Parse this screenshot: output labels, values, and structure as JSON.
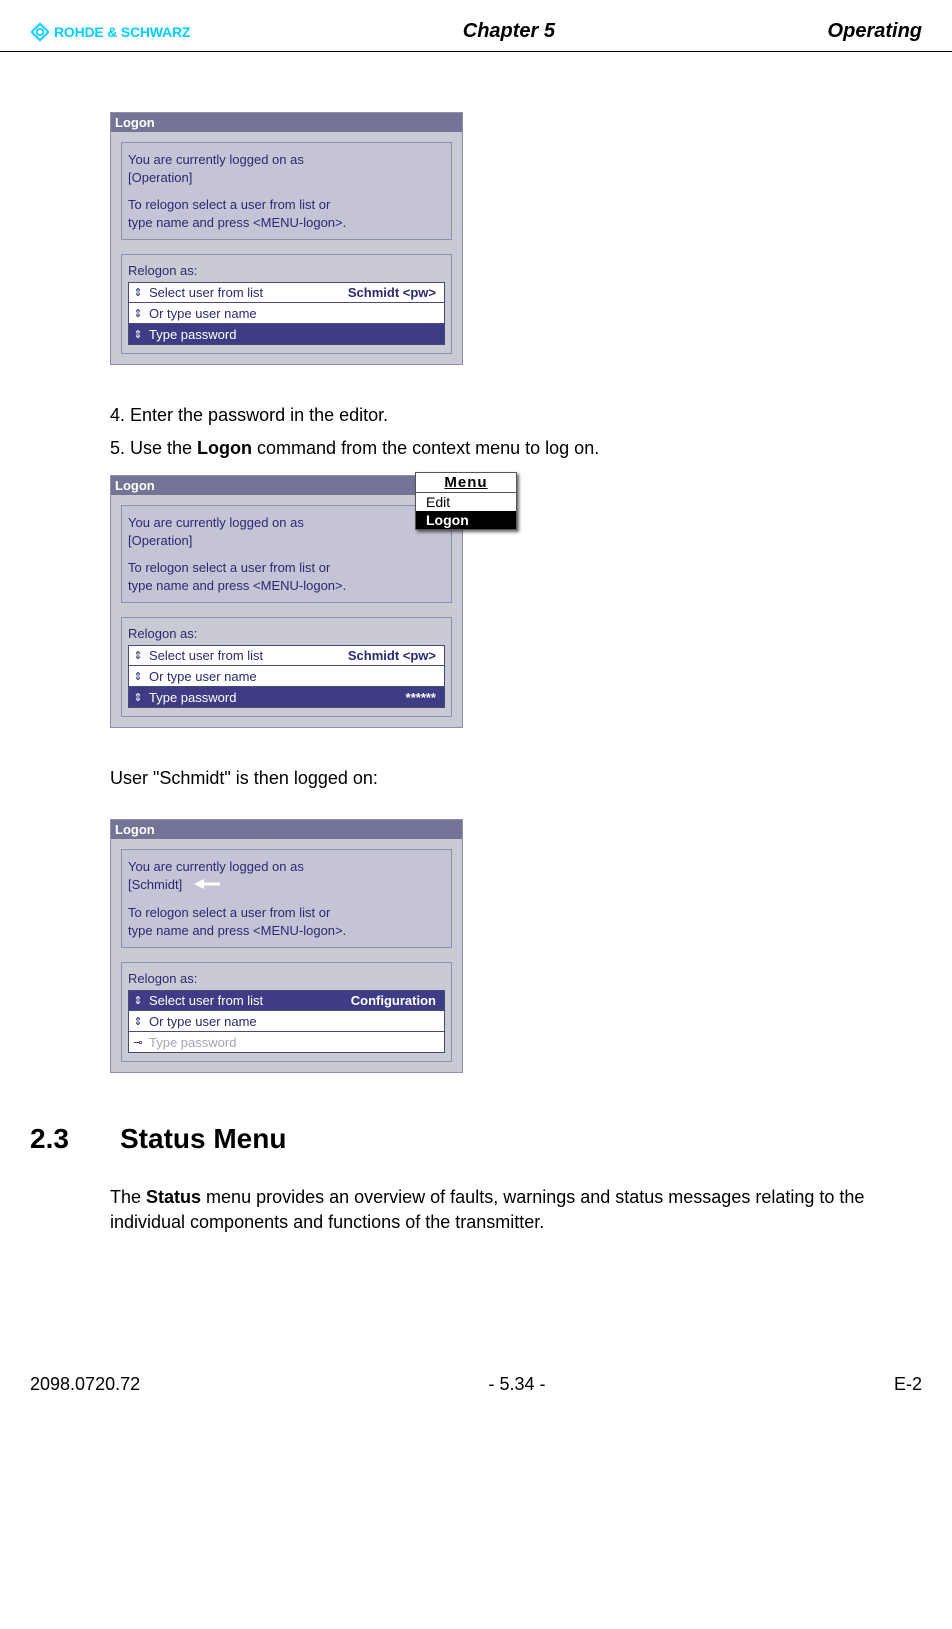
{
  "header": {
    "logo_text": "ROHDE & SCHWARZ",
    "chapter": "Chapter 5",
    "title": "Operating"
  },
  "dialog1": {
    "title": "Logon",
    "info_line1": "You are currently logged on as",
    "info_line2": "[Operation]",
    "info_line3": "To relogon select a user from list or",
    "info_line4": "type name and press <MENU-logon>.",
    "relogon_label": "Relogon as:",
    "f1_label": "Select user from list",
    "f1_value": "Schmidt <pw>",
    "f2_label": "Or type user name",
    "f3_label": "Type password"
  },
  "step4": "4.  Enter the password in the editor.",
  "step5_pre": "5.  Use the ",
  "step5_bold": "Logon",
  "step5_post": " command from the context menu to log on.",
  "dialog2": {
    "title": "Logon",
    "info_line1": "You are currently logged on as",
    "info_line2": "[Operation]",
    "info_line3": "To relogon select a user from list or",
    "info_line4": "type name and press <MENU-logon>.",
    "relogon_label": "Relogon as:",
    "f1_label": "Select user from list",
    "f1_value": "Schmidt <pw>",
    "f2_label": "Or type user name",
    "f3_label": "Type password",
    "f3_value": "******",
    "menu_title": "Menu",
    "menu_item1": "Edit",
    "menu_item2": "Logon"
  },
  "logged_on_text": "User \"Schmidt\" is then logged on:",
  "dialog3": {
    "title": "Logon",
    "info_line1": "You are currently logged on as",
    "info_line2": "[Schmidt]",
    "info_line3": "To relogon select a user from list or",
    "info_line4": "type name and press <MENU-logon>.",
    "relogon_label": "Relogon as:",
    "f1_label": "Select user from list",
    "f1_value": "Configuration",
    "f2_label": "Or type user name",
    "f3_label": "Type password"
  },
  "section": {
    "number": "2.3",
    "title": "Status Menu",
    "body_pre": "The ",
    "body_bold": "Status",
    "body_post": " menu provides an overview of faults, warnings and status messages relating to the individual components and functions of the transmitter."
  },
  "footer": {
    "left": "2098.0720.72",
    "center": "- 5.34 -",
    "right": "E-2"
  }
}
